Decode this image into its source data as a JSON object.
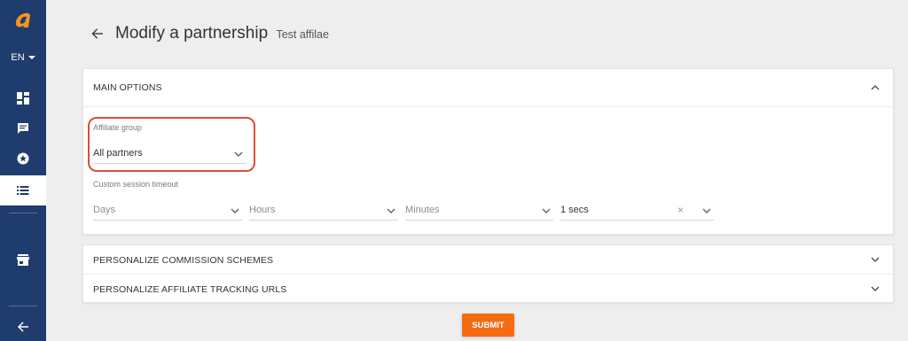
{
  "sidebar": {
    "language": "EN",
    "items": [
      {
        "icon": "dashboard-icon"
      },
      {
        "icon": "chat-icon"
      },
      {
        "icon": "star-badge-icon"
      },
      {
        "icon": "list-icon",
        "active": true
      },
      {
        "icon": "store-icon"
      },
      {
        "icon": "back-arrow-icon"
      }
    ],
    "colors": {
      "background": "#1f3c6e",
      "logo": "#f7941d"
    }
  },
  "header": {
    "title": "Modify a partnership",
    "subtitle": "Test affilae"
  },
  "main_options": {
    "title": "MAIN OPTIONS",
    "affiliate_group": {
      "label": "Affiliate group",
      "value": "All partners"
    },
    "custom_session_timeout": {
      "label": "Custom session timeout",
      "days_placeholder": "Days",
      "hours_placeholder": "Hours",
      "minutes_placeholder": "Minutes",
      "seconds_value": "1 secs",
      "clear_symbol": "×"
    }
  },
  "sections": [
    {
      "title": "PERSONALIZE COMMISSION SCHEMES"
    },
    {
      "title": "PERSONALIZE AFFILIATE TRACKING URLS"
    }
  ],
  "submit_label": "SUBMIT",
  "colors": {
    "accent": "#f46b14",
    "highlight": "#e04a3a"
  }
}
